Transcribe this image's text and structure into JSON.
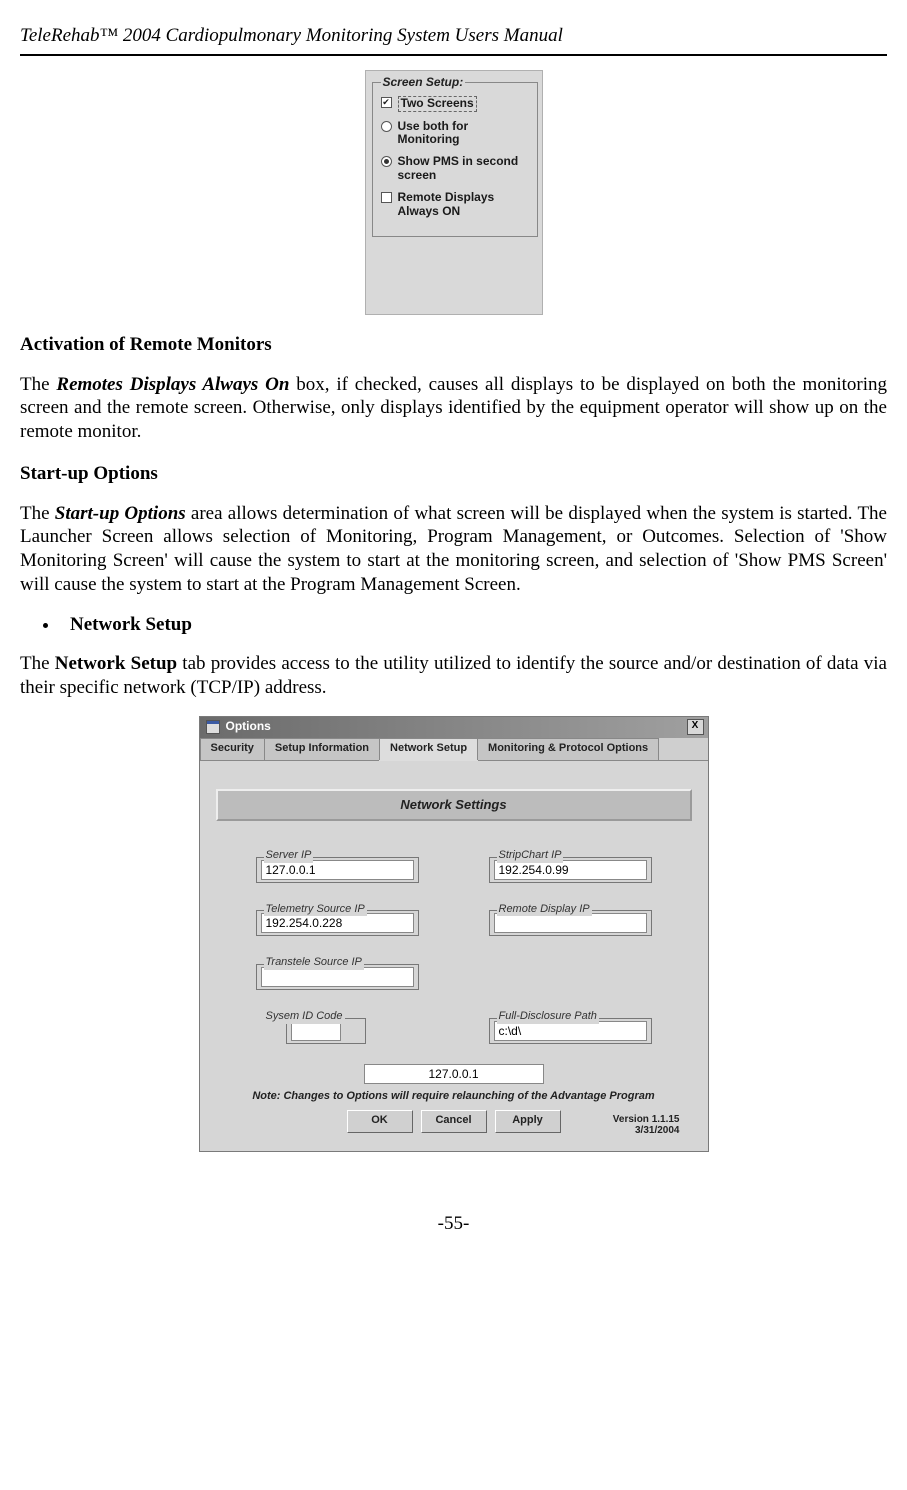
{
  "header_title": "TeleRehab™ 2004 Cardiopulmonary Monitoring System Users Manual",
  "screen_setup": {
    "legend": "Screen Setup:",
    "opt_two_screens": "Two Screens",
    "opt_use_both": "Use both for Monitoring",
    "opt_show_pms": "Show PMS in second screen",
    "opt_remote_always": "Remote Displays Always ON"
  },
  "sec1_title": "Activation of Remote Monitors",
  "para1_a": "The ",
  "para1_em": "Remotes Displays Always On",
  "para1_b": " box, if checked, causes all displays to be displayed on both the monitoring screen and the remote screen. Otherwise, only displays identified by the equipment operator will show up on the remote monitor.",
  "sec2_title": "Start-up Options",
  "para2_a": "The ",
  "para2_em": "Start-up Options",
  "para2_b": " area allows determination of what screen will be displayed when the system is started. The Launcher Screen allows selection of Monitoring, Program Management, or Outcomes. Selection of 'Show Monitoring Screen' will cause the system to start at the monitoring screen, and selection of 'Show PMS Screen' will cause the system to start at the Program Management Screen.",
  "bullet_network_setup": "Network Setup",
  "para3_a": "The ",
  "para3_strong": "Network Setup",
  "para3_b": " tab provides access to the utility utilized to identify the source and/or destination of data via their specific network (TCP/IP) address.",
  "options_dialog": {
    "title": "Options",
    "close_x": "X",
    "tabs": {
      "security": "Security",
      "setup_info": "Setup Information",
      "network_setup": "Network Setup",
      "monitoring": "Monitoring & Protocol Options"
    },
    "section_band": "Network Settings",
    "fields": {
      "server_ip_label": "Server IP",
      "server_ip_value": "127.0.0.1",
      "stripchart_ip_label": "StripChart IP",
      "stripchart_ip_value": "192.254.0.99",
      "telemetry_ip_label": "Telemetry Source IP",
      "telemetry_ip_value": "192.254.0.228",
      "remote_display_ip_label": "Remote Display IP",
      "remote_display_ip_value": "",
      "transtele_ip_label": "Transtele Source IP",
      "transtele_ip_value": "",
      "sysem_id_label": "Sysem ID Code",
      "sysem_id_value": "",
      "full_disclosure_label": "Full-Disclosure Path",
      "full_disclosure_value": "c:\\d\\",
      "center_ip_value": "127.0.0.1"
    },
    "footer_note": "Note: Changes to Options will require relaunching of the Advantage Program",
    "btn_ok": "OK",
    "btn_cancel": "Cancel",
    "btn_apply": "Apply",
    "version_line1": "Version 1.1.15",
    "version_line2": "3/31/2004"
  },
  "page_number": "-55-"
}
